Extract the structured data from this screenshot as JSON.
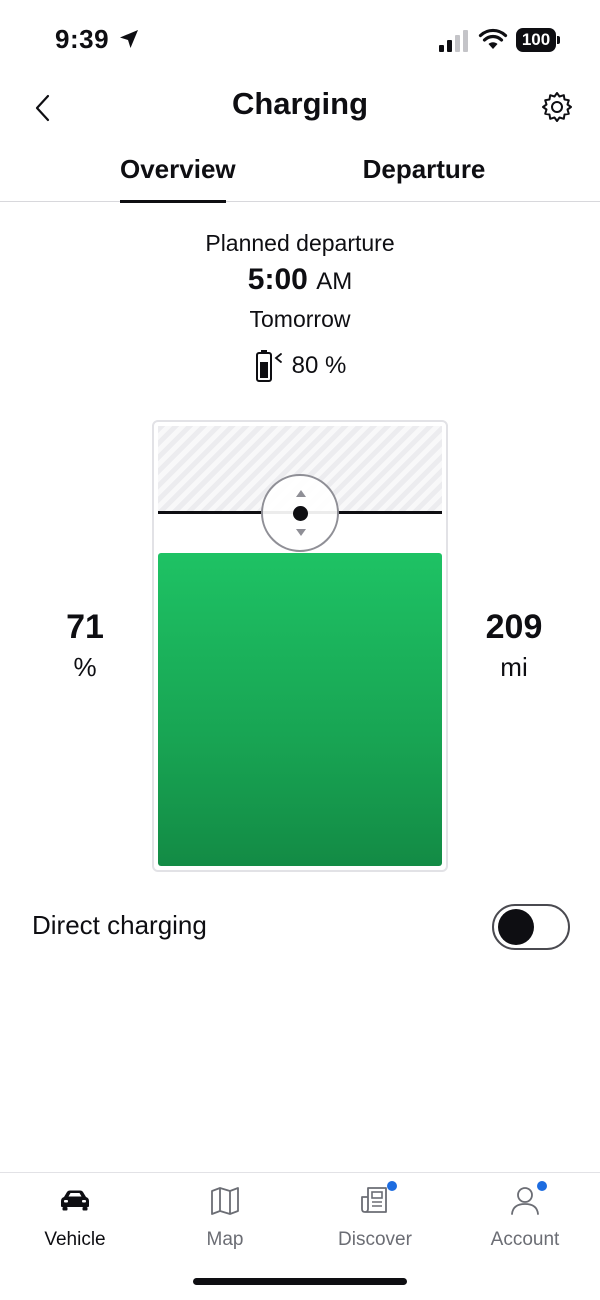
{
  "status_bar": {
    "time": "9:39",
    "battery_level": "100",
    "icons": [
      "location-arrow-icon",
      "cellular-signal-icon",
      "wifi-icon",
      "battery-icon"
    ]
  },
  "header": {
    "title": "Charging",
    "back_icon": "chevron-left-icon",
    "settings_icon": "gear-icon"
  },
  "tabs": [
    {
      "label": "Overview",
      "active": true
    },
    {
      "label": "Departure",
      "active": false
    }
  ],
  "departure": {
    "label": "Planned departure",
    "time": "5:00",
    "ampm": "AM",
    "day": "Tomorrow",
    "target_charge": "80 %"
  },
  "charge": {
    "state_of_charge": "71",
    "soc_unit": "%",
    "range": "209",
    "range_unit": "mi",
    "fill_color": "#1db45b",
    "target_percent": 80,
    "current_percent": 71
  },
  "direct_charging": {
    "label": "Direct charging",
    "enabled": false
  },
  "bottom_nav": {
    "items": [
      {
        "label": "Vehicle",
        "icon": "car-icon",
        "active": true,
        "badge": false
      },
      {
        "label": "Map",
        "icon": "map-icon",
        "active": false,
        "badge": false
      },
      {
        "label": "Discover",
        "icon": "news-icon",
        "active": false,
        "badge": true
      },
      {
        "label": "Account",
        "icon": "person-icon",
        "active": false,
        "badge": true
      }
    ],
    "badge_color": "#1d6ce0"
  }
}
